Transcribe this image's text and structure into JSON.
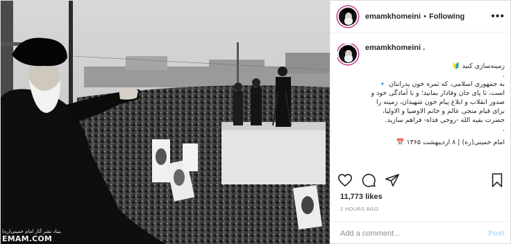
{
  "post": {
    "username": "emamkhomeini",
    "follow_status": "Following",
    "separator": "•",
    "more": "•••",
    "caption_username": "emamkhomeini .",
    "caption_lines": [
      "زمینه‌سازی کنید 🔰",
      ".",
      "به جمهوری اسلامی، که ثمره خون پدرانتان 🔹",
      "است، تا پای جان وفادار بمانید؛ و با آمادگی خود و",
      "صدور انقلاب و ابلاغ پیام خون شهیدان، زمینه را",
      "برای قیام منجی عالم و خاتم الاوصیا و الاولیا،",
      "حضرت بقیه الله -روحی فداه- فراهم سازید.",
      "."
    ],
    "signature": "امام خمینی(ره) | ۸ اردیبهشت ۱۳۶۵ 📅",
    "likes": "11,773 likes",
    "time": "2 HOURS AGO",
    "comment_placeholder": "Add a comment...",
    "post_button": "Post",
    "photo_credit_small": "بنیاد نشر آثار امام خمینی(ره)",
    "photo_credit_big": "EMAM.COM"
  },
  "icons": {
    "like": "heart-icon",
    "comment": "comment-icon",
    "share": "share-icon",
    "save": "bookmark-icon",
    "more": "more-options-icon"
  },
  "colors": {
    "story_ring": "#c9338b",
    "post_button": "#b2dffc",
    "muted_text": "#8e8e8e"
  }
}
